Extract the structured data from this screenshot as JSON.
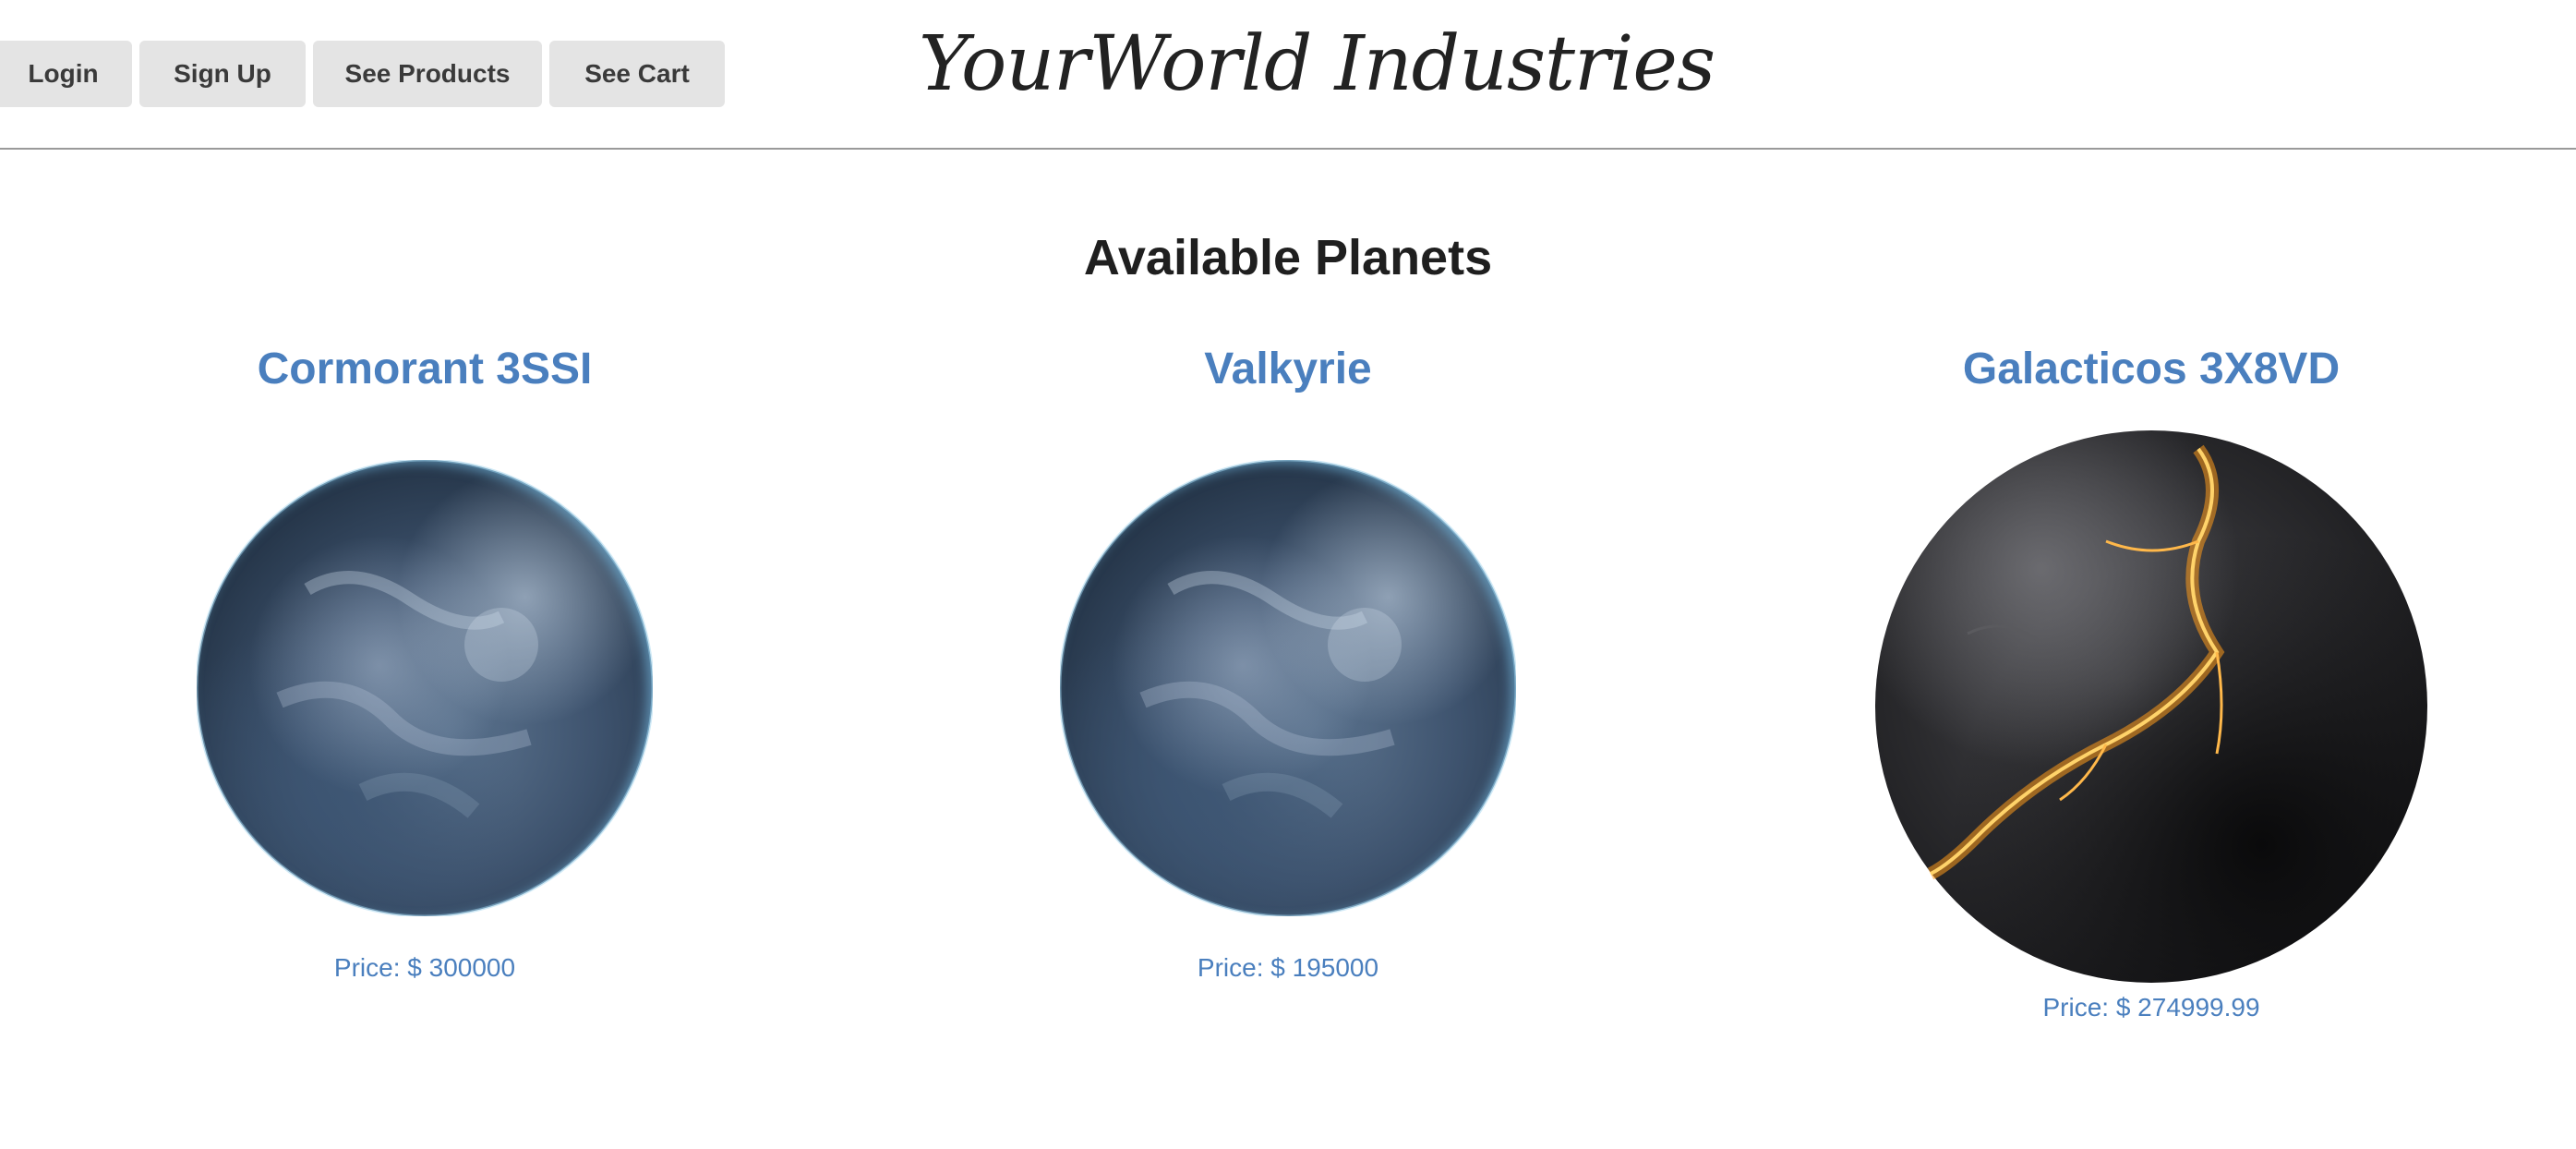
{
  "nav": {
    "login": "Login",
    "signup": "Sign Up",
    "products": "See Products",
    "cart": "See Cart"
  },
  "brand": "YourWorld Industries",
  "section_title": "Available Planets",
  "planets": [
    {
      "name": "Cormorant 3SSI",
      "price": "Price: $ 300000",
      "style": "blue-earth-planet"
    },
    {
      "name": "Valkyrie",
      "price": "Price: $ 195000",
      "style": "blue-earth-planet"
    },
    {
      "name": "Galacticos 3X8VD",
      "price": "Price: $ 274999.99",
      "style": "dark-lava-planet"
    }
  ],
  "colors": {
    "accent": "#4a7fbe",
    "button_bg": "#e4e4e4",
    "divider": "#9a9a9a"
  }
}
